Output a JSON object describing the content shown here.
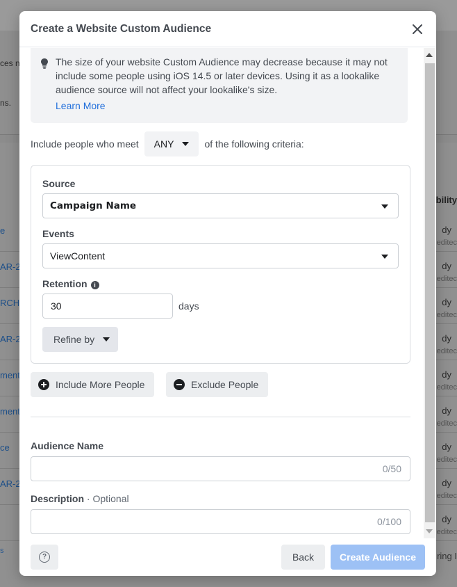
{
  "background": {
    "panel_lines": [
      "ces n",
      "ns."
    ],
    "rows": [
      {
        "link": "e",
        "status": "dy",
        "sub": "editec"
      },
      {
        "link": "AR-2",
        "status": "dy",
        "sub": "editec"
      },
      {
        "link": "RCHA",
        "status": "dy",
        "sub": "editec"
      },
      {
        "link": "AR-2",
        "status": "dy",
        "sub": "editec"
      },
      {
        "link": "ment A",
        "status": "dy",
        "sub": "editec"
      },
      {
        "link": "ment",
        "status": "dy",
        "sub": "editec"
      },
      {
        "link": "ce",
        "status": "dy",
        "sub": "editec"
      },
      {
        "link": "AR-2",
        "status": "dy",
        "sub": "editec"
      },
      {
        "link": "",
        "status": "dy",
        "sub": "editec"
      }
    ],
    "column_header": "bility",
    "bottom_link": "s",
    "bottom_right": "ring I"
  },
  "modal": {
    "title": "Create a Website Custom Audience",
    "notice": {
      "text": "The size of your website Custom Audience may decrease because it may not include some people using iOS 14.5 or later devices. Using it as a lookalike audience source will not affect your lookalike's size.",
      "link": "Learn More"
    },
    "criteria": {
      "prefix": "Include people who meet",
      "selector": "ANY",
      "suffix": "of the following criteria:"
    },
    "rule": {
      "source_label": "Source",
      "source_value": "Campaign Name",
      "events_label": "Events",
      "events_value": "ViewContent",
      "retention_label": "Retention",
      "retention_value": "30",
      "retention_unit": "days",
      "refine_label": "Refine by"
    },
    "include_more_label": "Include More People",
    "exclude_label": "Exclude People",
    "audience_name": {
      "label": "Audience Name",
      "counter": "0/50"
    },
    "description": {
      "label": "Description",
      "optional": "· Optional",
      "counter": "0/100"
    },
    "footer": {
      "back": "Back",
      "create": "Create Audience"
    }
  }
}
